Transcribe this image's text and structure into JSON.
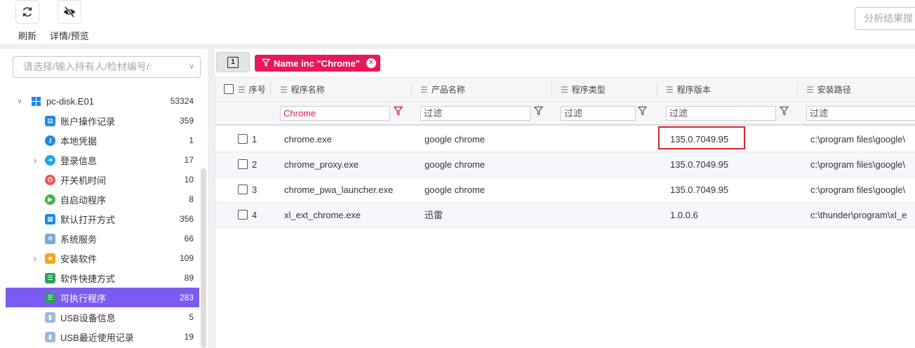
{
  "toolbar": {
    "refresh_label": "刷新",
    "refresh_icon": "refresh-icon",
    "detail_label": "详情/预览",
    "detail_icon": "eye-slash-icon",
    "search_placeholder": "分析结果搜"
  },
  "sidebar": {
    "search_placeholder": "请选择/输入持有人/检材编号/:",
    "root": {
      "label": "pc-disk.E01",
      "count": "53324"
    },
    "items": [
      {
        "label": "账户操作记录",
        "count": "359",
        "icon": "account-log-icon",
        "color": "#1e88e5",
        "expandable": false
      },
      {
        "label": "本地凭据",
        "count": "1",
        "icon": "key-icon",
        "color": "#1e88e5",
        "expandable": false
      },
      {
        "label": "登录信息",
        "count": "17",
        "icon": "login-icon",
        "color": "#1ea7e5",
        "expandable": true
      },
      {
        "label": "开关机时间",
        "count": "10",
        "icon": "power-icon",
        "color": "#ef5350",
        "expandable": false
      },
      {
        "label": "自启动程序",
        "count": "8",
        "icon": "play-icon",
        "color": "#43b649",
        "expandable": false
      },
      {
        "label": "默认打开方式",
        "count": "356",
        "icon": "apps-icon",
        "color": "#1e88e5",
        "expandable": false
      },
      {
        "label": "系统服务",
        "count": "66",
        "icon": "gears-icon",
        "color": "#7fa6d8",
        "expandable": false
      },
      {
        "label": "安装软件",
        "count": "109",
        "icon": "package-icon",
        "color": "#f5a623",
        "expandable": true
      },
      {
        "label": "软件快捷方式",
        "count": "89",
        "icon": "list-icon",
        "color": "#2e9e5b",
        "expandable": false
      },
      {
        "label": "可执行程序",
        "count": "283",
        "icon": "list-icon",
        "color": "#2e9e5b",
        "expandable": false,
        "active": true
      },
      {
        "label": "USB设备信息",
        "count": "5",
        "icon": "usb-icon",
        "color": "#9ab8e0",
        "expandable": false
      },
      {
        "label": "USB最近使用记录",
        "count": "19",
        "icon": "usb-icon",
        "color": "#9ab8e0",
        "expandable": false
      }
    ]
  },
  "filter_chip": {
    "label": "Name inc \"Chrome\"",
    "pin_glyph": "1"
  },
  "table": {
    "columns": [
      "序号",
      "程序名称",
      "产品名称",
      "程序类型",
      "程序版本",
      "安装路径"
    ],
    "filters": [
      "Chrome",
      "过滤",
      "过滤",
      "过滤",
      "过滤"
    ],
    "rows": [
      {
        "no": "1",
        "name": "chrome.exe",
        "product": "google chrome",
        "type": "",
        "version": "135.0.7049.95",
        "path": "c:\\program files\\google\\"
      },
      {
        "no": "2",
        "name": "chrome_proxy.exe",
        "product": "google chrome",
        "type": "",
        "version": "135.0.7049.95",
        "path": "c:\\program files\\google\\"
      },
      {
        "no": "3",
        "name": "chrome_pwa_launcher.exe",
        "product": "google chrome",
        "type": "",
        "version": "135.0.7049.95",
        "path": "c:\\program files\\google\\"
      },
      {
        "no": "4",
        "name": "xl_ext_chrome.exe",
        "product": "迅雷",
        "type": "",
        "version": "1.0.0.6",
        "path": "c:\\thunder\\program\\xl_e"
      }
    ]
  },
  "colors": {
    "accent": "#7b5cf0",
    "chip": "#e8195b",
    "highlight_box": "#d4232b"
  }
}
